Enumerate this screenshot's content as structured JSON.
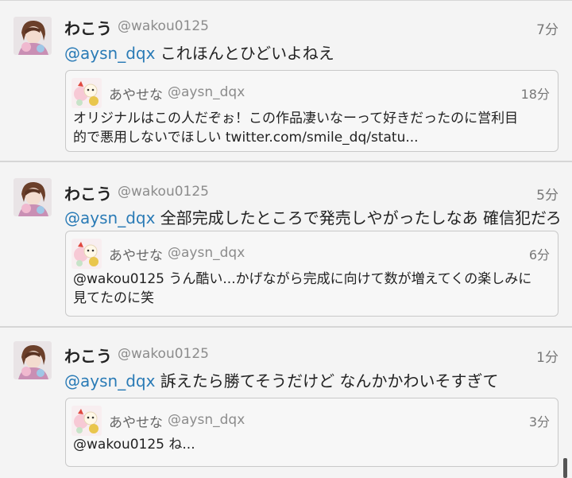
{
  "tweets": [
    {
      "author": {
        "name": "わこう",
        "handle": "@wakou0125",
        "avatar": "anime-avatar-brown-hair"
      },
      "time": "7分",
      "reply_to": "@aysn_dqx",
      "text": "これほんとひどいよねえ",
      "quote": {
        "author": {
          "name": "あやせな",
          "handle": "@aysn_dqx",
          "avatar": "pastel-mascot-avatar"
        },
        "time": "18分",
        "line1": "オリジナルはこの人だぞぉ！この作品凄いなーって好きだったのに営利目",
        "line2": "的で悪用しないでほしい twitter.com/smile_dq/statu..."
      }
    },
    {
      "author": {
        "name": "わこう",
        "handle": "@wakou0125",
        "avatar": "anime-avatar-brown-hair"
      },
      "time": "5分",
      "reply_to": "@aysn_dqx",
      "text": "全部完成したところで発売しやがったしなあ 確信犯だろ",
      "quote": {
        "author": {
          "name": "あやせな",
          "handle": "@aysn_dqx",
          "avatar": "pastel-mascot-avatar"
        },
        "time": "6分",
        "line1": "@wakou0125 うん酷い...かげながら完成に向けて数が増えてくの楽しみに",
        "line2": "見てたのに笑"
      }
    },
    {
      "author": {
        "name": "わこう",
        "handle": "@wakou0125",
        "avatar": "anime-avatar-brown-hair"
      },
      "time": "1分",
      "reply_to": "@aysn_dqx",
      "text": "訴えたら勝てそうだけど なんかかわいそすぎて",
      "quote": {
        "author": {
          "name": "あやせな",
          "handle": "@aysn_dqx",
          "avatar": "pastel-mascot-avatar"
        },
        "time": "3分",
        "line1": "@wakou0125 ね...",
        "line2": ""
      }
    }
  ],
  "colors": {
    "mention": "#2a7bb6",
    "background": "#f4f4f4",
    "divider": "#d6d6d6"
  }
}
